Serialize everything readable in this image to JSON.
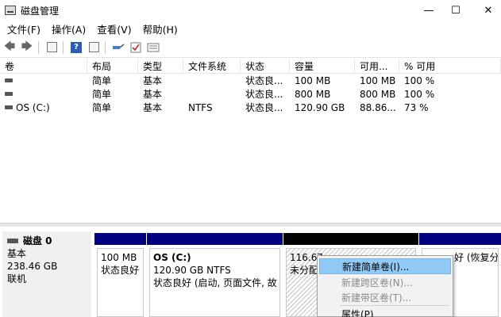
{
  "window": {
    "title": "磁盘管理",
    "icon": "disk-management-icon",
    "minimize": "—",
    "maximize": "☐",
    "close": "✕"
  },
  "menu": [
    "文件(F)",
    "操作(A)",
    "查看(V)",
    "帮助(H)"
  ],
  "toolbar": {
    "icons": [
      "back-arrow-icon",
      "forward-arrow-icon",
      "console-tree-icon",
      "help-icon",
      "properties-icon",
      "connect-icon",
      "check-icon",
      "settings-icon"
    ],
    "back": "🡄",
    "forward": "🡆",
    "help": "?"
  },
  "volumes": {
    "columns": [
      "卷",
      "布局",
      "类型",
      "文件系统",
      "状态",
      "容量",
      "可用...",
      "% 可用"
    ],
    "rows": [
      [
        "",
        "简单",
        "基本",
        "",
        "状态良...",
        "100 MB",
        "100 MB",
        "100 %"
      ],
      [
        "",
        "简单",
        "基本",
        "",
        "状态良...",
        "800 MB",
        "800 MB",
        "100 %"
      ],
      [
        "OS (C:)",
        "简单",
        "基本",
        "NTFS",
        "状态良...",
        "120.90 GB",
        "88.86...",
        "73 %"
      ]
    ]
  },
  "disk": {
    "name": "磁盘 0",
    "type": "基本",
    "size": "238.46 GB",
    "status": "联机",
    "partitions": [
      {
        "title": "",
        "size": "100 MB",
        "status": "状态良好"
      },
      {
        "title": "OS  (C:)",
        "size": "120.90 GB NTFS",
        "status": "状态良好 (启动, 页面文件, 故"
      },
      {
        "title": "",
        "size": "116.67",
        "status": "未分配"
      },
      {
        "title": "",
        "size": "",
        "status": "好 (恢复分"
      }
    ]
  },
  "context_menu": {
    "items": [
      {
        "label": "新建简单卷(I)...",
        "enabled": true,
        "highlighted": true
      },
      {
        "label": "新建跨区卷(N)...",
        "enabled": false
      },
      {
        "label": "新建带区卷(T)...",
        "enabled": false
      },
      {
        "label": "属性(P)",
        "enabled": true
      }
    ]
  },
  "colors": {
    "partition_bar": "#000080",
    "unallocated_bar": "#000000",
    "menu_highlight": "#91c9f7"
  }
}
